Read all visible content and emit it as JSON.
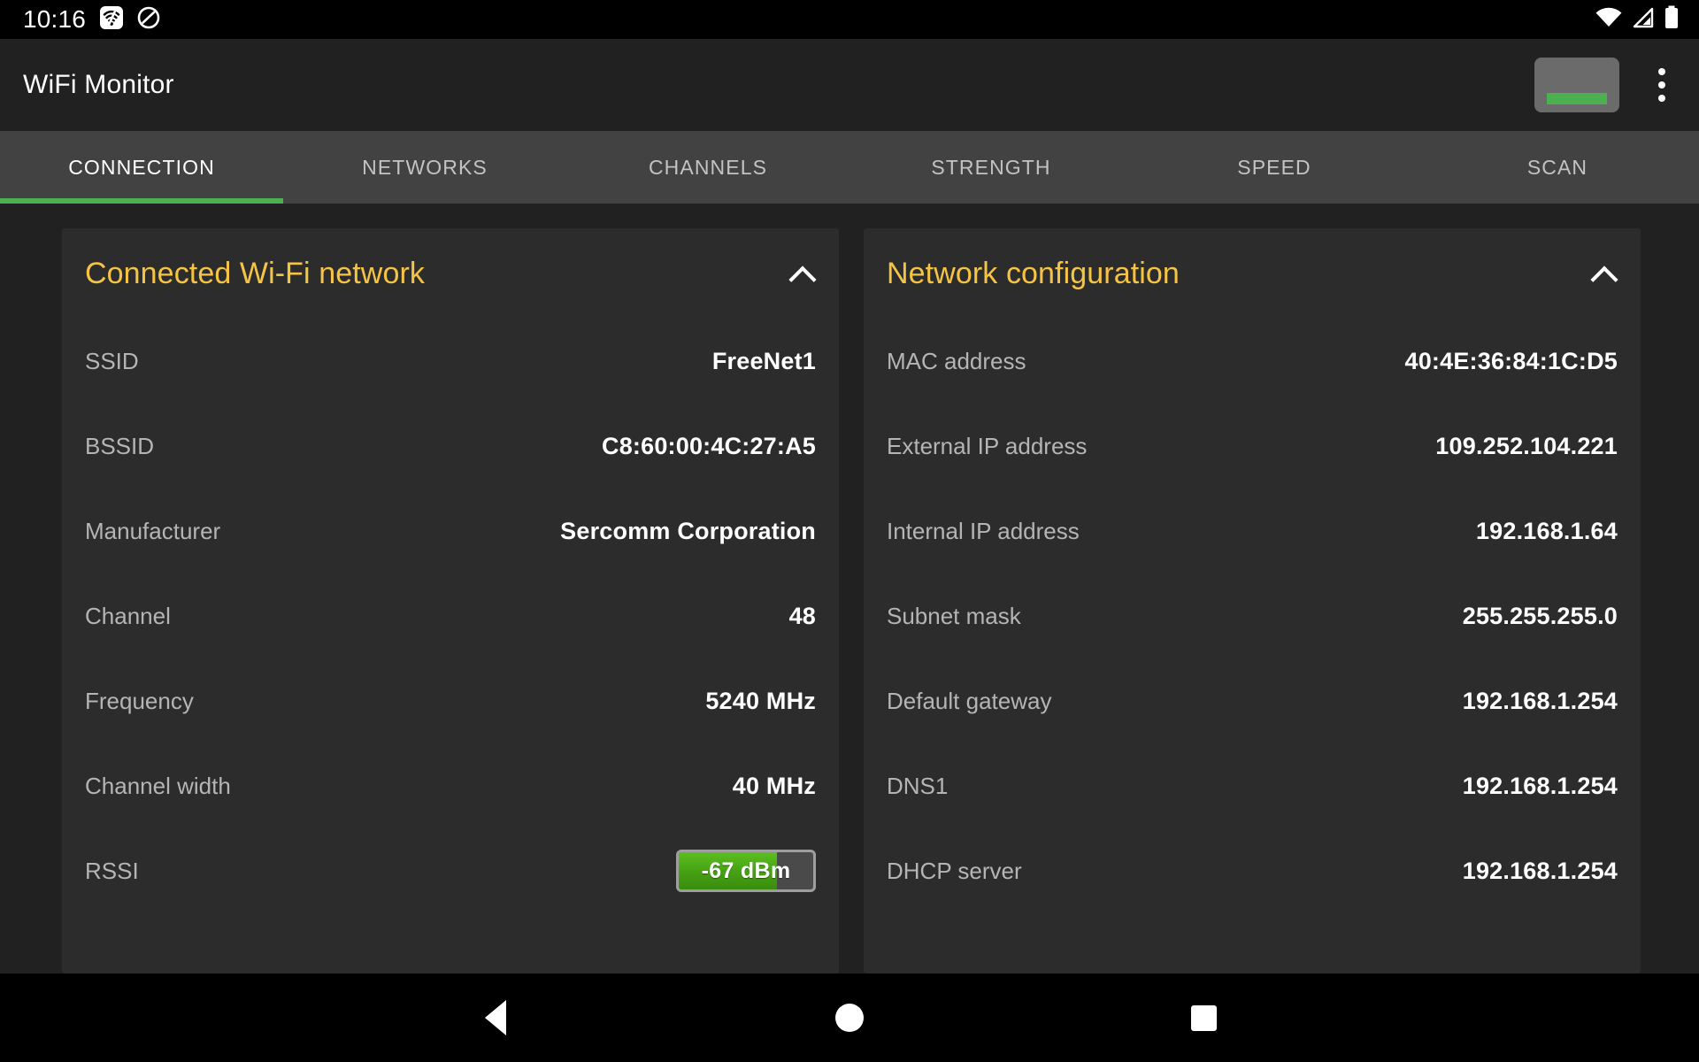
{
  "status_bar": {
    "clock": "10:16",
    "left_icons": [
      "wifi-analyzer-app-icon",
      "do-not-disturb-icon"
    ],
    "right_icons": [
      "wifi-signal-icon",
      "cellular-signal-off-icon",
      "battery-full-icon"
    ]
  },
  "app_bar": {
    "title": "WiFi Monitor",
    "level_button_name": "signal-level-button",
    "overflow_label": "More options",
    "accent_green": "#4caf50"
  },
  "tabs": [
    {
      "label": "CONNECTION",
      "active": true
    },
    {
      "label": "NETWORKS",
      "active": false
    },
    {
      "label": "CHANNELS",
      "active": false
    },
    {
      "label": "STRENGTH",
      "active": false
    },
    {
      "label": "SPEED",
      "active": false
    },
    {
      "label": "SCAN",
      "active": false
    }
  ],
  "cards": [
    {
      "title": "Connected Wi-Fi network",
      "collapse_state": "expanded",
      "title_color": "#f6c445",
      "rows": [
        {
          "label": "SSID",
          "value": "FreeNet1"
        },
        {
          "label": "BSSID",
          "value": "C8:60:00:4C:27:A5"
        },
        {
          "label": "Manufacturer",
          "value": "Sercomm Corporation"
        },
        {
          "label": "Channel",
          "value": "48"
        },
        {
          "label": "Frequency",
          "value": "5240 MHz"
        },
        {
          "label": "Channel width",
          "value": "40 MHz"
        },
        {
          "label": "RSSI",
          "value": "-67 dBm",
          "type": "meter",
          "meter_percent": 73,
          "meter_color": "#45a012"
        }
      ]
    },
    {
      "title": "Network configuration",
      "collapse_state": "expanded",
      "title_color": "#f6c445",
      "rows": [
        {
          "label": "MAC address",
          "value": "40:4E:36:84:1C:D5"
        },
        {
          "label": "External IP address",
          "value": "109.252.104.221"
        },
        {
          "label": "Internal IP address",
          "value": "192.168.1.64"
        },
        {
          "label": "Subnet mask",
          "value": "255.255.255.0"
        },
        {
          "label": "Default gateway",
          "value": "192.168.1.254"
        },
        {
          "label": "DNS1",
          "value": "192.168.1.254"
        },
        {
          "label": "DHCP server",
          "value": "192.168.1.254"
        }
      ]
    }
  ],
  "nav_bar": {
    "back": "back-button",
    "home": "home-button",
    "recents": "recents-button"
  }
}
